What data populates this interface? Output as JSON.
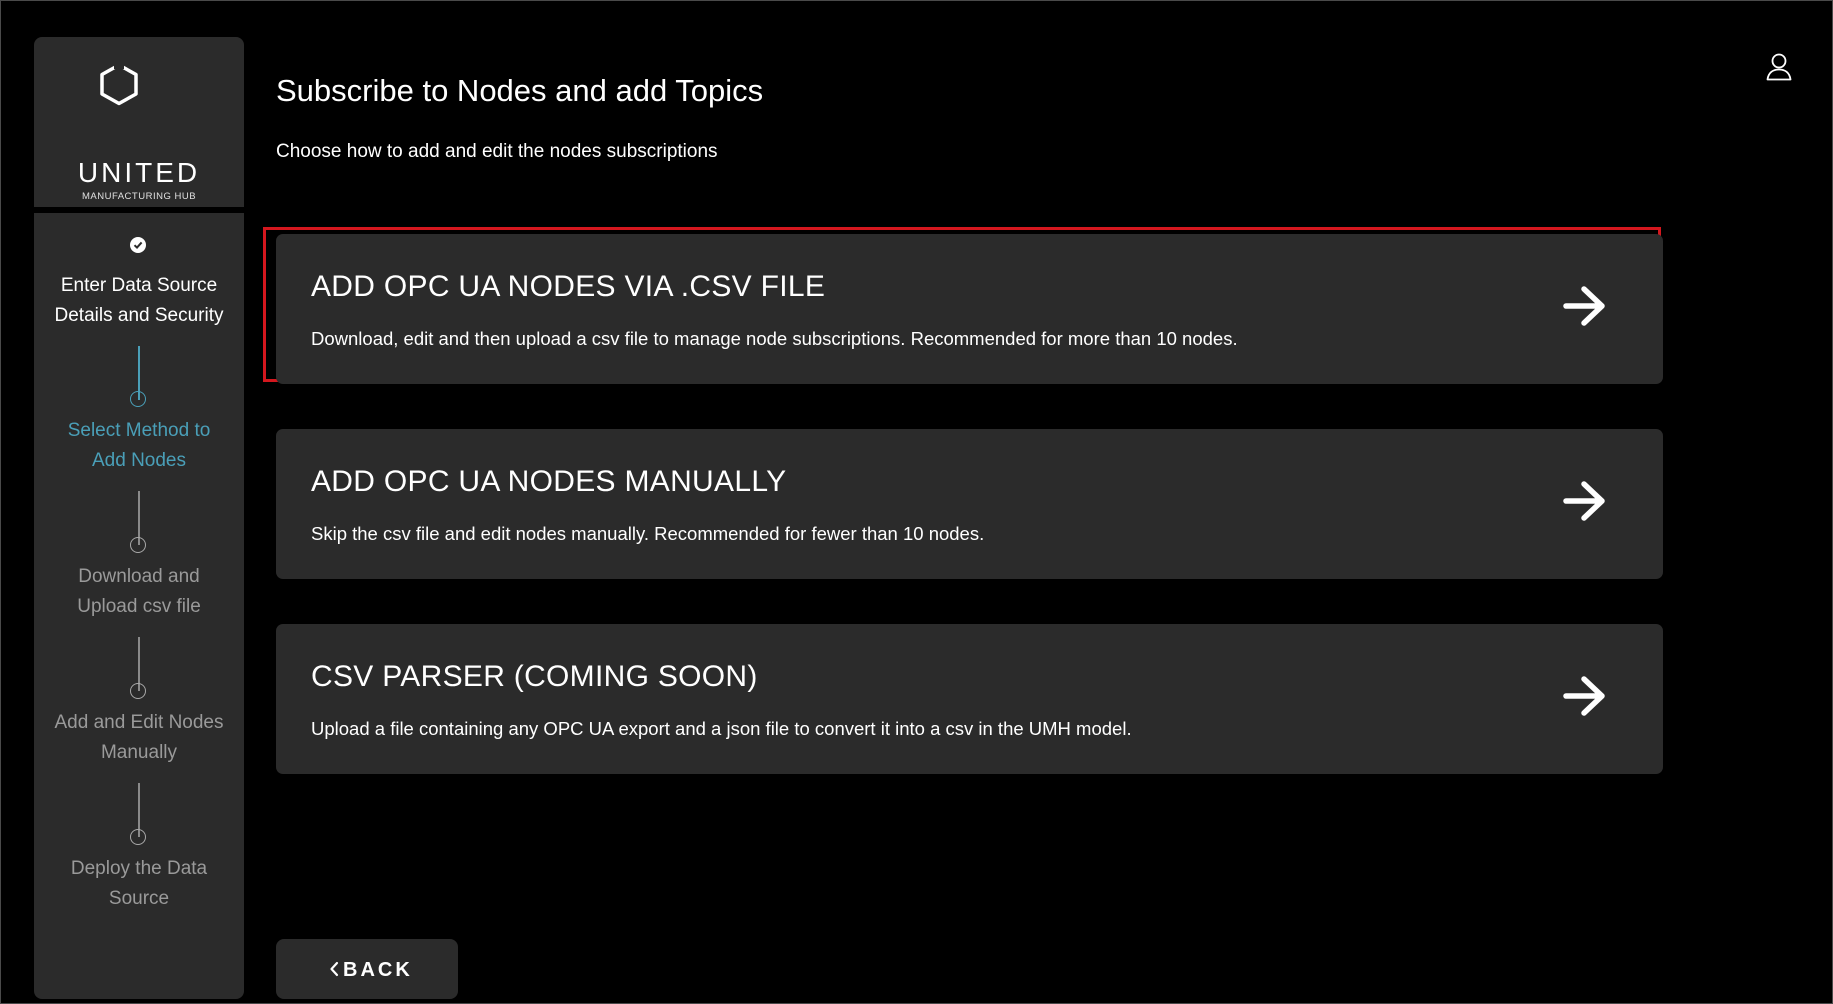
{
  "header": {
    "title": "Subscribe to Nodes and add Topics",
    "subtitle": "Choose how to add and edit the nodes subscriptions"
  },
  "brand": {
    "name": "UNITED",
    "tagline": "MANUFACTURING HUB",
    "logo_icon": "hexagon-logo-icon"
  },
  "steps": [
    {
      "label_line1": "Enter Data Source",
      "label_line2": "Details and Security",
      "status": "done"
    },
    {
      "label_line1": "Select Method to",
      "label_line2": "Add Nodes",
      "status": "active"
    },
    {
      "label_line1": "Download and",
      "label_line2": "Upload csv file",
      "status": "pending"
    },
    {
      "label_line1": "Add and Edit Nodes",
      "label_line2": "Manually",
      "status": "pending"
    },
    {
      "label_line1": "Deploy the Data",
      "label_line2": "Source",
      "status": "pending"
    }
  ],
  "options": [
    {
      "title": "ADD OPC UA NODES VIA .CSV FILE",
      "description": "Download, edit and then upload a csv file to manage node subscriptions. Recommended for more than 10 nodes.",
      "icon": "arrow-right-icon",
      "highlighted": true
    },
    {
      "title": "ADD OPC UA NODES MANUALLY",
      "description": "Skip the csv file and edit nodes manually. Recommended for fewer than 10 nodes.",
      "icon": "arrow-right-icon",
      "highlighted": false
    },
    {
      "title": "CSV PARSER (COMING SOON)",
      "description": "Upload a file containing any OPC UA export and a json file to convert it into a csv in the UMH model.",
      "icon": "arrow-right-icon",
      "highlighted": false
    }
  ],
  "footer": {
    "back_label": "BACK"
  },
  "colors": {
    "background": "#000000",
    "panel": "#2b2b2b",
    "accent": "#4a9fb8",
    "highlight": "#d4171e",
    "muted": "#9a9a9a"
  }
}
